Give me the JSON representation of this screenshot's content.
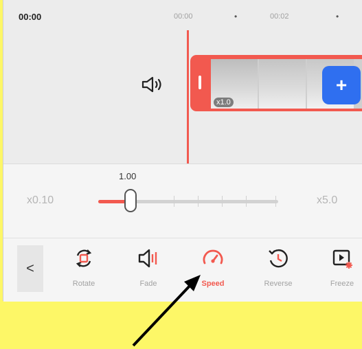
{
  "timeline": {
    "current_time": "00:00",
    "ruler": [
      "00:00",
      "00:02"
    ],
    "clip_speed": "x1.0",
    "add_label": "+"
  },
  "speed": {
    "value": "1.00",
    "min_label": "x0.10",
    "max_label": "x5.0"
  },
  "toolbar": {
    "back_label": "<",
    "tools": [
      {
        "label": "Rotate",
        "icon": "rotate-icon",
        "active": false
      },
      {
        "label": "Fade",
        "icon": "fade-icon",
        "active": false
      },
      {
        "label": "Speed",
        "icon": "speedometer-icon",
        "active": true
      },
      {
        "label": "Reverse",
        "icon": "reverse-icon",
        "active": false
      },
      {
        "label": "Freeze",
        "icon": "freeze-icon",
        "active": false
      }
    ]
  },
  "colors": {
    "accent": "#f2594f",
    "add_button": "#2f6ff0",
    "background": "#fdf767"
  }
}
